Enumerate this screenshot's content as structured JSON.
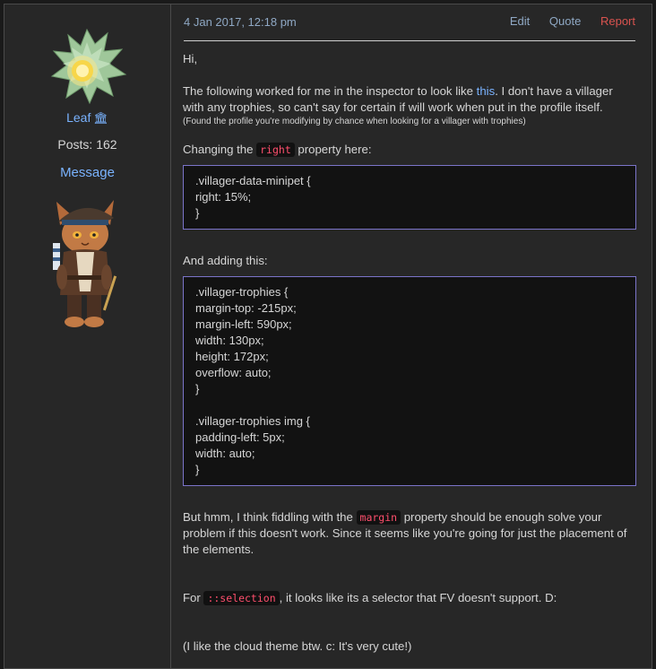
{
  "user": {
    "name": "Leaf",
    "badge_icon": "bank-icon",
    "posts": "Posts: 162",
    "message": "Message"
  },
  "post": {
    "date": "4 Jan 2017, 12:18 pm",
    "actions": {
      "edit": "Edit",
      "quote": "Quote",
      "report": "Report"
    },
    "greeting": "Hi,",
    "intro_before": "The following worked for me in the inspector to look like ",
    "intro_link": "this",
    "intro_after": ". I don't have a villager with any trophies, so can't say for certain if will work when put in the profile itself.",
    "note": "(Found the profile you're modifying by chance when looking for a villager with trophies)",
    "changing_before": "Changing the ",
    "changing_code": "right",
    "changing_after": " property here:",
    "code1": [
      ".villager-data-minipet {",
      "right: 15%;",
      "}"
    ],
    "adding": "And adding this:",
    "code2": [
      ".villager-trophies {",
      "margin-top: -215px;",
      "margin-left: 590px;",
      "width: 130px;",
      "height: 172px;",
      "overflow: auto;",
      "}",
      "",
      ".villager-trophies img {",
      "padding-left: 5px;",
      "width: auto;",
      "}"
    ],
    "but_before": "But hmm, I think fiddling with the ",
    "but_code": "margin",
    "but_after": " property should be enough solve your problem if this doesn't work. Since it seems like you're going for just the placement of the elements.",
    "for_before": "For ",
    "for_code": "::selection",
    "for_after": ", it looks like its a selector that FV doesn't support. D:",
    "closing": "(I like the cloud theme btw. c: It's very cute!)"
  },
  "colors": {
    "link": "#7ab3ff",
    "report": "#d9534f",
    "inline_code": "#ff4f6d",
    "code_border": "#7b74c9"
  }
}
